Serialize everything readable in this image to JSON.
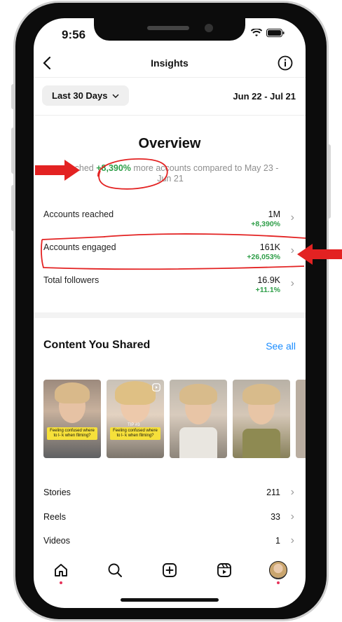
{
  "status_bar": {
    "time": "9:56"
  },
  "header": {
    "title": "Insights"
  },
  "date_filter": {
    "selected": "Last 30 Days",
    "range_label": "Jun 22 - Jul 21"
  },
  "overview": {
    "title": "Overview",
    "summary_prefix": "reached",
    "summary_percent": "+8,390%",
    "summary_suffix": "more accounts compared to May 23 - Jun 21"
  },
  "metrics": [
    {
      "label": "Accounts reached",
      "value": "1M",
      "change": "+8,390%"
    },
    {
      "label": "Accounts engaged",
      "value": "161K",
      "change": "+26,053%"
    },
    {
      "label": "Total followers",
      "value": "16.9K",
      "change": "+11.1%"
    }
  ],
  "content": {
    "title": "Content You Shared",
    "see_all": "See all",
    "thumbnails": [
      {
        "caption": "Feeling confused where to l- k when filming?"
      },
      {
        "caption": "Feeling confused where to l- k when filming?",
        "tip": "TIP #3"
      },
      {
        "caption": ""
      },
      {
        "caption": ""
      }
    ]
  },
  "counts": [
    {
      "label": "Stories",
      "value": "211"
    },
    {
      "label": "Reels",
      "value": "33"
    },
    {
      "label": "Videos",
      "value": "1"
    }
  ],
  "annotation_color": "#e32222",
  "accent_color": "#1a8cff",
  "positive_color": "#2e9e48"
}
